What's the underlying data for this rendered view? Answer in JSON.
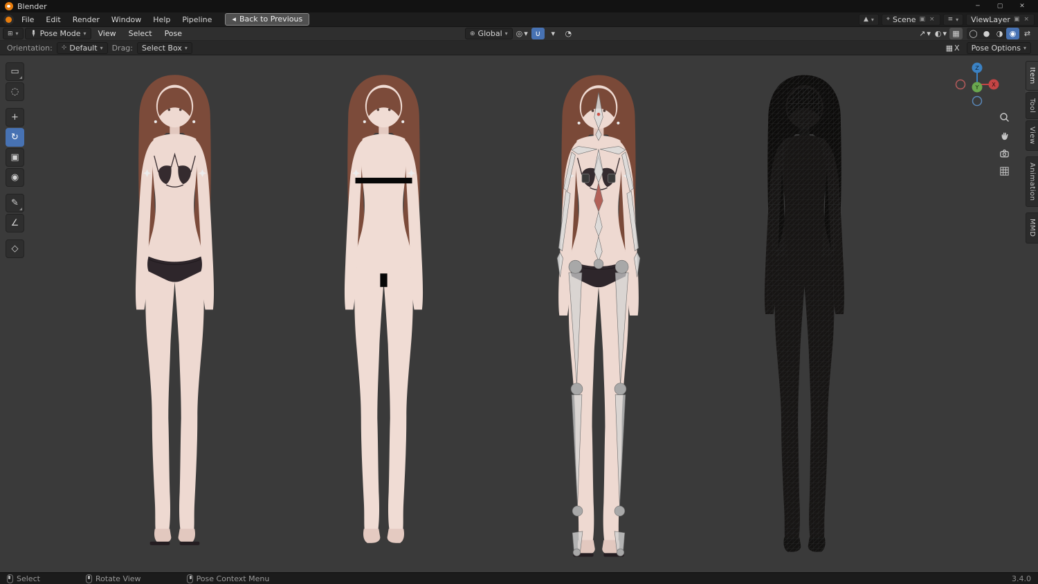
{
  "window": {
    "title": "Blender",
    "minimize": "─",
    "maximize": "▢",
    "close": "✕"
  },
  "menubar": {
    "items": [
      "File",
      "Edit",
      "Render",
      "Window",
      "Help",
      "Pipeline"
    ],
    "back_button": "Back to Previous",
    "scene_label": "Scene",
    "viewlayer_label": "ViewLayer"
  },
  "header": {
    "mode": "Pose Mode",
    "menus": [
      "View",
      "Select",
      "Pose"
    ],
    "orientation": "Global"
  },
  "options": {
    "orientation_label": "Orientation:",
    "orientation_value": "Default",
    "drag_label": "Drag:",
    "drag_value": "Select Box",
    "mirror_x": "X",
    "pose_options": "Pose Options"
  },
  "tools": [
    {
      "name": "select-box",
      "glyph": "▭"
    },
    {
      "name": "cursor",
      "glyph": "◌"
    },
    {
      "name": "move",
      "glyph": "+"
    },
    {
      "name": "rotate",
      "glyph": "↻"
    },
    {
      "name": "scale",
      "glyph": "▣"
    },
    {
      "name": "transform",
      "glyph": "◉"
    },
    {
      "name": "annotate",
      "glyph": "✎"
    },
    {
      "name": "measure",
      "glyph": "∠"
    },
    {
      "name": "pose-breakdowner",
      "glyph": "◇"
    }
  ],
  "gizmo": {
    "z": "Z",
    "y": "Y",
    "x": "X"
  },
  "sidebar_tabs": [
    "Item",
    "Tool",
    "View",
    "Animation",
    "MMD"
  ],
  "statusbar": {
    "hints": [
      "Select",
      "Rotate View",
      "Pose Context Menu"
    ],
    "version": "3.4.0"
  },
  "icons": {
    "editor_type": "⊞",
    "dropdown": "▾",
    "back": "◂",
    "global": "⊕",
    "pivot": "◎",
    "magnet": "∪",
    "prop_edit": "◔",
    "gizmo_toggle": "↗",
    "overlays": "◐",
    "xray": "▦",
    "shade_wire": "◯",
    "shade_solid": "●",
    "shade_material": "◑",
    "shade_render": "◉",
    "swap": "⇄",
    "scene": "▲",
    "viewlayer": "≡",
    "dup": "▣",
    "close_x": "×",
    "pin": "⌖",
    "axis": "⊹",
    "grid_box": "▦"
  },
  "accent_colors": {
    "selection_blue": "#4772b3",
    "axis_x": "#c44545",
    "axis_y": "#6aa84f",
    "axis_z": "#3b82c4"
  }
}
